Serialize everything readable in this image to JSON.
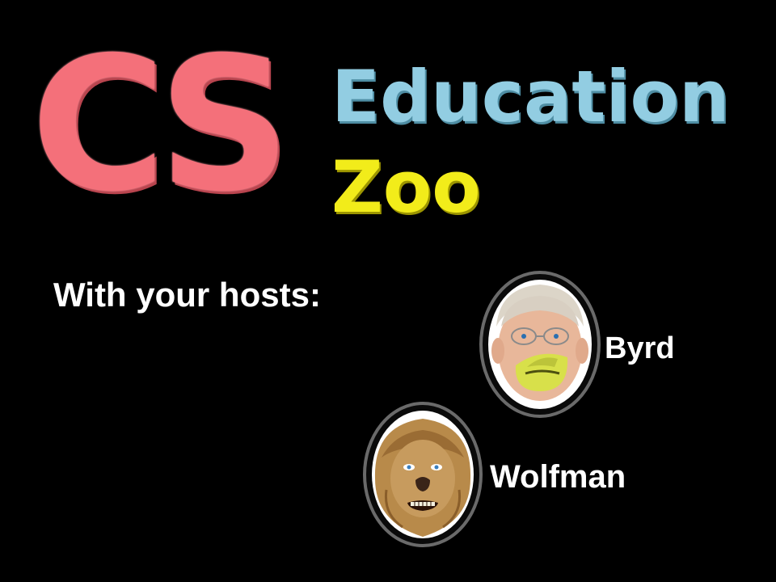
{
  "logo": {
    "cs": "CS",
    "education": "Education",
    "zoo": "Zoo"
  },
  "heading": "With your hosts:",
  "hosts": [
    {
      "name": "Byrd",
      "portrait_icon": "byrd-portrait-icon"
    },
    {
      "name": "Wolfman",
      "portrait_icon": "wolfman-portrait-icon"
    }
  ],
  "colors": {
    "background": "#000000",
    "cs": "#f4707a",
    "education": "#92cde2",
    "zoo": "#f2ec1a",
    "text": "#ffffff"
  }
}
